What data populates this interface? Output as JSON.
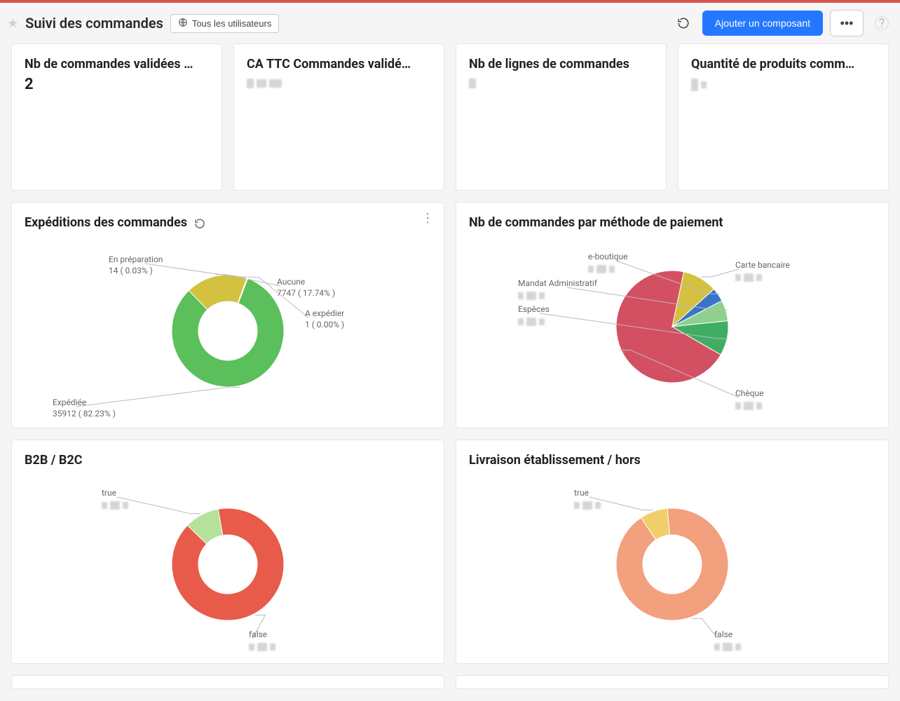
{
  "header": {
    "title": "Suivi des commandes",
    "filter_label": "Tous les utilisateurs",
    "add_component_label": "Ajouter un composant"
  },
  "kpi_cards": [
    {
      "title": "Nb de commandes validées …",
      "value": "2",
      "value_hidden": false
    },
    {
      "title": "CA TTC Commandes validé…",
      "value": "",
      "value_hidden": true
    },
    {
      "title": "Nb de lignes de commandes",
      "value": "",
      "value_hidden": true
    },
    {
      "title": "Quantité de produits comm…",
      "value": "",
      "value_hidden": true
    }
  ],
  "charts": {
    "expeditions": {
      "title": "Expéditions des commandes",
      "has_refresh": true,
      "has_menu": true
    },
    "paiement": {
      "title": "Nb de commandes par méthode de paiement"
    },
    "b2b": {
      "title": "B2B / B2C"
    },
    "livraison": {
      "title": "Livraison établissement / hors"
    }
  },
  "chart_data": [
    {
      "id": "expeditions",
      "type": "donut",
      "title": "Expéditions des commandes",
      "series": [
        {
          "name": "Expédiée",
          "value": 35912,
          "percent": 82.23,
          "color": "#5bbf5b"
        },
        {
          "name": "Aucune",
          "value": 7747,
          "percent": 17.74,
          "color": "#d4c13f"
        },
        {
          "name": "En préparation",
          "value": 14,
          "percent": 0.03,
          "color": "#8ed08e"
        },
        {
          "name": "A expédier",
          "value": 1,
          "percent": 0.0,
          "color": "#c0c0c0"
        }
      ]
    },
    {
      "id": "paiement",
      "type": "pie",
      "title": "Nb de commandes par méthode de paiement",
      "series": [
        {
          "name": "Chèque",
          "percent": 70,
          "color": "#d35062",
          "value_hidden": true
        },
        {
          "name": "Carte bancaire",
          "percent": 10,
          "color": "#d4c13f",
          "value_hidden": true
        },
        {
          "name": "e-boutique",
          "percent": 4,
          "color": "#3776c6",
          "value_hidden": true
        },
        {
          "name": "Mandat Administratif",
          "percent": 6,
          "color": "#8ed08e",
          "value_hidden": true
        },
        {
          "name": "Espèces",
          "percent": 10,
          "color": "#3fae62",
          "value_hidden": true
        }
      ]
    },
    {
      "id": "b2b",
      "type": "donut",
      "title": "B2B / B2C",
      "series": [
        {
          "name": "false",
          "percent": 90,
          "color": "#e85b4a",
          "value_hidden": true
        },
        {
          "name": "true",
          "percent": 10,
          "color": "#b5e19a",
          "value_hidden": true
        }
      ]
    },
    {
      "id": "livraison",
      "type": "donut",
      "title": "Livraison établissement / hors",
      "series": [
        {
          "name": "false",
          "percent": 92,
          "color": "#f2a07d",
          "value_hidden": true
        },
        {
          "name": "true",
          "percent": 8,
          "color": "#f0cf6b",
          "value_hidden": true
        }
      ]
    }
  ]
}
